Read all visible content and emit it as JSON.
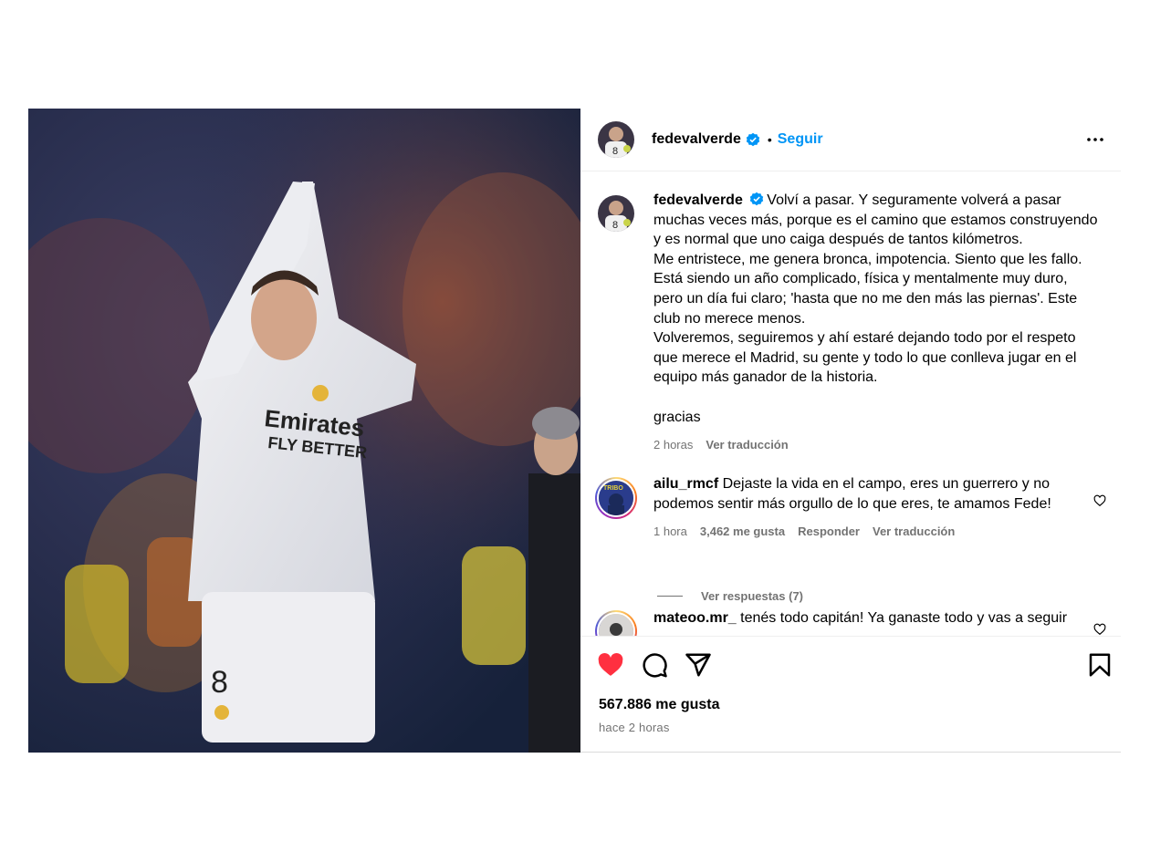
{
  "post": {
    "username": "fedevalverde",
    "follow_label": "Seguir",
    "separator": "•"
  },
  "icons": {
    "verified": "verified-badge-icon",
    "more": "more-options-icon",
    "like": "heart-filled-icon",
    "comment": "comment-icon",
    "share": "send-icon",
    "save": "bookmark-icon"
  },
  "colors": {
    "accent": "#0095f6",
    "like": "#ff3040",
    "secondary_text": "#737373"
  },
  "caption": {
    "username": "fedevalverde",
    "lines": [
      "Volví a pasar. Y seguramente volverá a pasar",
      "muchas veces más, porque es el camino que estamos construyendo",
      "y es normal que uno caiga después de tantos kilómetros.",
      "Me entristece, me genera bronca, impotencia. Siento que les fallo.",
      "Está siendo un año complicado, física y mentalmente muy duro,",
      "pero un día fui claro; 'hasta que no me den más las piernas'. Este",
      "club no merece menos.",
      "Volveremos, seguiremos y ahí estaré dejando todo por el respeto",
      "que merece el Madrid, su gente y todo lo que conlleva jugar en el",
      "equipo más ganador de la historia."
    ],
    "closing": "gracias",
    "time": "2 horas",
    "translate": "Ver traducción"
  },
  "comments": [
    {
      "username": "ailu_rmcf",
      "text_line1": "Dejaste la vida en el campo, eres un guerrero y no",
      "text_line2": "podemos sentir más orgullo de lo que eres, te amamos Fede!",
      "time": "1 hora",
      "likes": "3,462 me gusta",
      "reply": "Responder",
      "translate": "Ver traducción",
      "view_replies": "Ver respuestas (7)"
    },
    {
      "username": "mateoo.mr_",
      "text_line1": "tenés todo capitán! Ya ganaste todo y vas a seguir"
    }
  ],
  "footer": {
    "likes": "567.886 me gusta",
    "time": "hace 2 horas"
  }
}
